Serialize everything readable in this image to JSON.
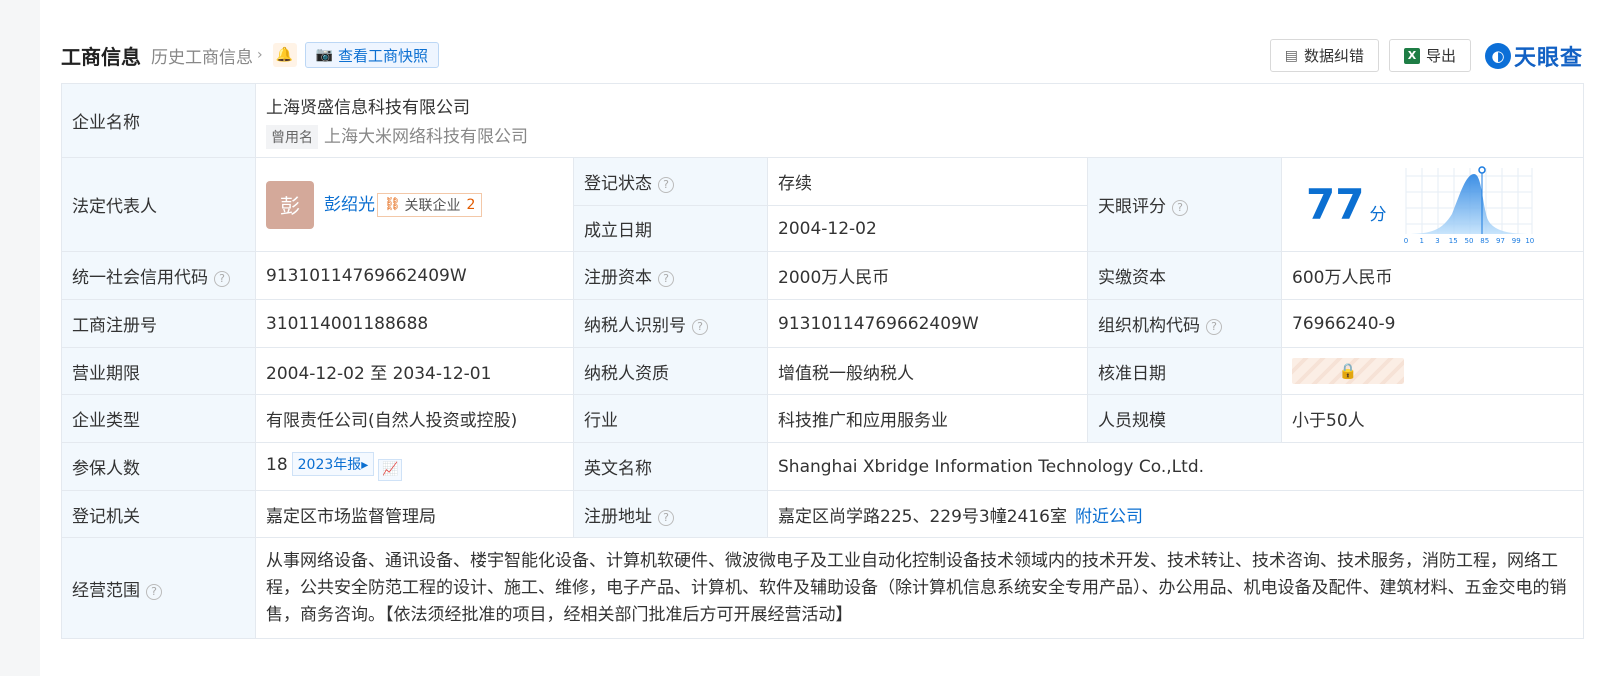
{
  "header": {
    "title": "工商信息",
    "history_link": "历史工商信息",
    "snapshot_button": "查看工商快照",
    "report_error_button": "数据纠错",
    "export_button": "导出",
    "logo_text": "天眼查"
  },
  "company": {
    "name_label": "企业名称",
    "name": "上海贤盛信息科技有限公司",
    "former_tag": "曾用名",
    "former_name": "上海大米网络科技有限公司"
  },
  "legal_rep": {
    "label": "法定代表人",
    "avatar_char": "彭",
    "name": "彭绍光",
    "related_label": "关联企业",
    "related_count": "2"
  },
  "reg_status": {
    "label": "登记状态",
    "value": "存续"
  },
  "found_date": {
    "label": "成立日期",
    "value": "2004-12-02"
  },
  "score": {
    "label": "天眼评分",
    "value": "77",
    "unit": "分",
    "scale_ticks": [
      "0",
      "1",
      "3",
      "15",
      "50",
      "85",
      "97",
      "99",
      "100"
    ]
  },
  "rows": {
    "credit_code": {
      "label": "统一社会信用代码",
      "value": "91310114769662409W"
    },
    "reg_capital": {
      "label": "注册资本",
      "value": "2000万人民币"
    },
    "paid_capital": {
      "label": "实缴资本",
      "value": "600万人民币"
    },
    "reg_no": {
      "label": "工商注册号",
      "value": "310114001188688"
    },
    "taxpayer_id": {
      "label": "纳税人识别号",
      "value": "91310114769662409W"
    },
    "org_code": {
      "label": "组织机构代码",
      "value": "76966240-9"
    },
    "term": {
      "label": "营业期限",
      "value": "2004-12-02 至 2034-12-01"
    },
    "tax_quality": {
      "label": "纳税人资质",
      "value": "增值税一般纳税人"
    },
    "approve_date": {
      "label": "核准日期"
    },
    "company_type": {
      "label": "企业类型",
      "value": "有限责任公司(自然人投资或控股)"
    },
    "industry": {
      "label": "行业",
      "value": "科技推广和应用服务业"
    },
    "staff_size": {
      "label": "人员规模",
      "value": "小于50人"
    },
    "insured": {
      "label": "参保人数",
      "value": "18",
      "year_tag": "2023年报"
    },
    "english_name": {
      "label": "英文名称",
      "value": "Shanghai Xbridge Information Technology Co.,Ltd."
    },
    "authority": {
      "label": "登记机关",
      "value": "嘉定区市场监督管理局"
    },
    "address": {
      "label": "注册地址",
      "value": "嘉定区尚学路225、229号3幢2416室",
      "nearby_link": "附近公司"
    },
    "scope": {
      "label": "经营范围",
      "value": "从事网络设备、通讯设备、楼宇智能化设备、计算机软硬件、微波微电子及工业自动化控制设备技术领域内的技术开发、技术转让、技术咨询、技术服务，消防工程，网络工程，公共安全防范工程的设计、施工、维修，电子产品、计算机、软件及辅助设备（除计算机信息系统安全专用产品）、办公用品、机电设备及配件、建筑材料、五金交电的销售，商务咨询。【依法须经批准的项目，经相关部门批准后方可开展经营活动】"
    }
  },
  "colors": {
    "accent": "#0b6fd1",
    "status_green": "#1a9a3d",
    "label_bg": "#f2f8fd",
    "related_orange": "#e25b00"
  },
  "icons": [
    "bell-icon",
    "camera-icon",
    "document-icon",
    "excel-icon",
    "help-icon",
    "related-company-icon",
    "lock-icon",
    "trend-chart-icon",
    "chevron-right-icon"
  ]
}
